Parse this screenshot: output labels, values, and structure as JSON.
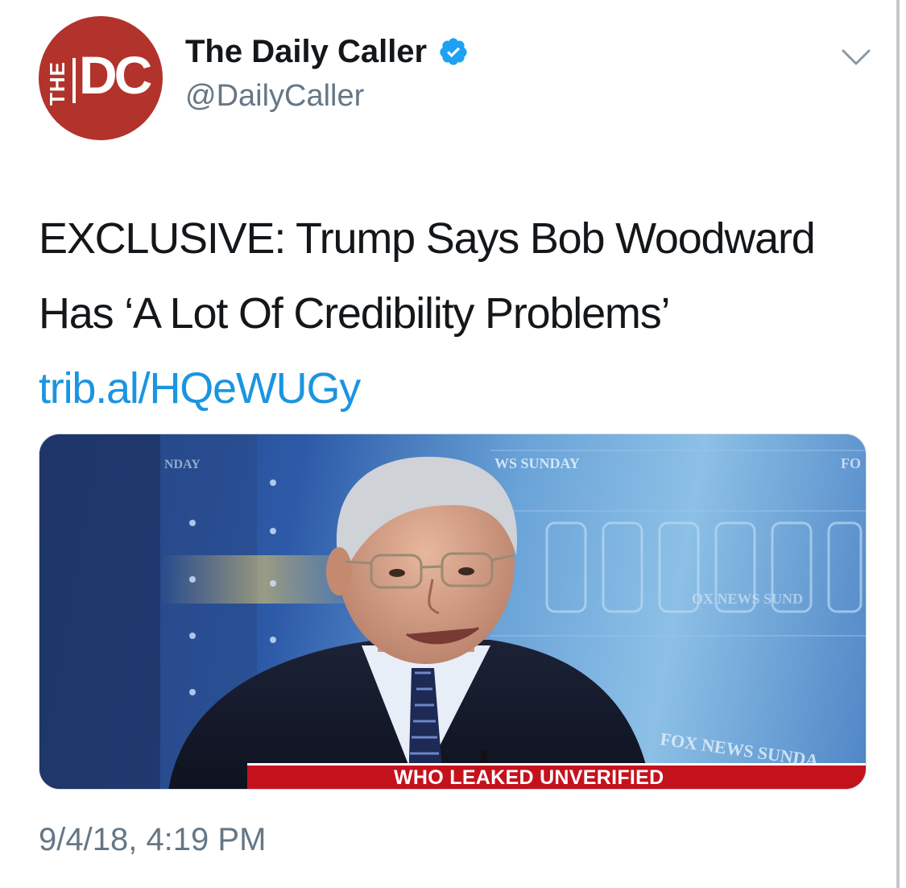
{
  "account": {
    "display_name": "The Daily Caller",
    "handle": "@DailyCaller",
    "verified": true,
    "avatar_logo": {
      "prefix": "THE",
      "letters": "DC"
    },
    "avatar_color": "#b2332b"
  },
  "tweet": {
    "text": "EXCLUSIVE: Trump Says Bob Woodward Has ‘A Lot Of Credibility Problems’",
    "link": "trib.al/HQeWUGy",
    "timestamp": "9/4/18, 4:19 PM"
  },
  "media": {
    "chyron": "WHO LEAKED UNVERIFIED",
    "background_texts": [
      "NDAY",
      "WS SUNDAY",
      "FO",
      "OX NEWS SUND",
      "FOX NEWS SUNDA"
    ]
  },
  "colors": {
    "text": "#14171a",
    "muted": "#657786",
    "link": "#1b95e0",
    "verified": "#1da1f2",
    "chyron": "#c4121d"
  },
  "icons": [
    "verified-badge-icon",
    "chevron-down-icon"
  ]
}
